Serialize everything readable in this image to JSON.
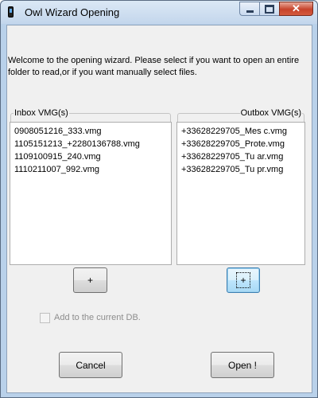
{
  "window": {
    "title": "Owl Wizard Opening",
    "close_glyph": "✕",
    "icons": [
      "app-phone-icon",
      "minimize-icon",
      "maximize-icon",
      "close-icon"
    ]
  },
  "intro": {
    "text": "Welcome to the opening wizard. Please select if you want to open an entire folder to read,or if you want manually select files."
  },
  "inbox": {
    "title": "Inbox VMG(s)",
    "items": [
      "0908051216_333.vmg",
      "1105151213_+2280136788.vmg",
      "1109100915_240.vmg",
      "1110211007_992.vmg"
    ],
    "add_label": "+"
  },
  "outbox": {
    "title": "Outbox VMG(s)",
    "items": [
      "+33628229705_Mes c.vmg",
      "+33628229705_Prote.vmg",
      "+33628229705_Tu ar.vmg",
      "+33628229705_Tu pr.vmg"
    ],
    "add_label": "+"
  },
  "options": {
    "add_to_db_label": "Add to the current DB.",
    "add_to_db_checked": false,
    "add_to_db_enabled": false
  },
  "footer": {
    "cancel_label": "Cancel",
    "open_label": "Open !"
  }
}
